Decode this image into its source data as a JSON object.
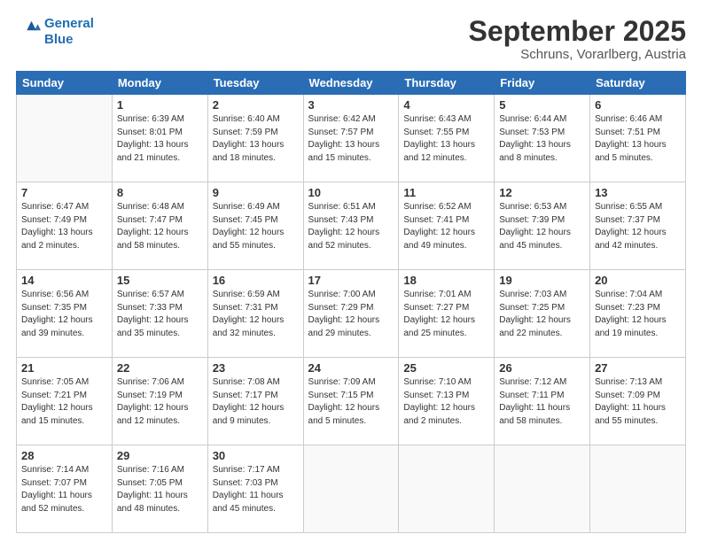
{
  "logo": {
    "line1": "General",
    "line2": "Blue"
  },
  "title": "September 2025",
  "subtitle": "Schruns, Vorarlberg, Austria",
  "weekdays": [
    "Sunday",
    "Monday",
    "Tuesday",
    "Wednesday",
    "Thursday",
    "Friday",
    "Saturday"
  ],
  "weeks": [
    [
      {
        "day": "",
        "text": ""
      },
      {
        "day": "1",
        "text": "Sunrise: 6:39 AM\nSunset: 8:01 PM\nDaylight: 13 hours\nand 21 minutes."
      },
      {
        "day": "2",
        "text": "Sunrise: 6:40 AM\nSunset: 7:59 PM\nDaylight: 13 hours\nand 18 minutes."
      },
      {
        "day": "3",
        "text": "Sunrise: 6:42 AM\nSunset: 7:57 PM\nDaylight: 13 hours\nand 15 minutes."
      },
      {
        "day": "4",
        "text": "Sunrise: 6:43 AM\nSunset: 7:55 PM\nDaylight: 13 hours\nand 12 minutes."
      },
      {
        "day": "5",
        "text": "Sunrise: 6:44 AM\nSunset: 7:53 PM\nDaylight: 13 hours\nand 8 minutes."
      },
      {
        "day": "6",
        "text": "Sunrise: 6:46 AM\nSunset: 7:51 PM\nDaylight: 13 hours\nand 5 minutes."
      }
    ],
    [
      {
        "day": "7",
        "text": "Sunrise: 6:47 AM\nSunset: 7:49 PM\nDaylight: 13 hours\nand 2 minutes."
      },
      {
        "day": "8",
        "text": "Sunrise: 6:48 AM\nSunset: 7:47 PM\nDaylight: 12 hours\nand 58 minutes."
      },
      {
        "day": "9",
        "text": "Sunrise: 6:49 AM\nSunset: 7:45 PM\nDaylight: 12 hours\nand 55 minutes."
      },
      {
        "day": "10",
        "text": "Sunrise: 6:51 AM\nSunset: 7:43 PM\nDaylight: 12 hours\nand 52 minutes."
      },
      {
        "day": "11",
        "text": "Sunrise: 6:52 AM\nSunset: 7:41 PM\nDaylight: 12 hours\nand 49 minutes."
      },
      {
        "day": "12",
        "text": "Sunrise: 6:53 AM\nSunset: 7:39 PM\nDaylight: 12 hours\nand 45 minutes."
      },
      {
        "day": "13",
        "text": "Sunrise: 6:55 AM\nSunset: 7:37 PM\nDaylight: 12 hours\nand 42 minutes."
      }
    ],
    [
      {
        "day": "14",
        "text": "Sunrise: 6:56 AM\nSunset: 7:35 PM\nDaylight: 12 hours\nand 39 minutes."
      },
      {
        "day": "15",
        "text": "Sunrise: 6:57 AM\nSunset: 7:33 PM\nDaylight: 12 hours\nand 35 minutes."
      },
      {
        "day": "16",
        "text": "Sunrise: 6:59 AM\nSunset: 7:31 PM\nDaylight: 12 hours\nand 32 minutes."
      },
      {
        "day": "17",
        "text": "Sunrise: 7:00 AM\nSunset: 7:29 PM\nDaylight: 12 hours\nand 29 minutes."
      },
      {
        "day": "18",
        "text": "Sunrise: 7:01 AM\nSunset: 7:27 PM\nDaylight: 12 hours\nand 25 minutes."
      },
      {
        "day": "19",
        "text": "Sunrise: 7:03 AM\nSunset: 7:25 PM\nDaylight: 12 hours\nand 22 minutes."
      },
      {
        "day": "20",
        "text": "Sunrise: 7:04 AM\nSunset: 7:23 PM\nDaylight: 12 hours\nand 19 minutes."
      }
    ],
    [
      {
        "day": "21",
        "text": "Sunrise: 7:05 AM\nSunset: 7:21 PM\nDaylight: 12 hours\nand 15 minutes."
      },
      {
        "day": "22",
        "text": "Sunrise: 7:06 AM\nSunset: 7:19 PM\nDaylight: 12 hours\nand 12 minutes."
      },
      {
        "day": "23",
        "text": "Sunrise: 7:08 AM\nSunset: 7:17 PM\nDaylight: 12 hours\nand 9 minutes."
      },
      {
        "day": "24",
        "text": "Sunrise: 7:09 AM\nSunset: 7:15 PM\nDaylight: 12 hours\nand 5 minutes."
      },
      {
        "day": "25",
        "text": "Sunrise: 7:10 AM\nSunset: 7:13 PM\nDaylight: 12 hours\nand 2 minutes."
      },
      {
        "day": "26",
        "text": "Sunrise: 7:12 AM\nSunset: 7:11 PM\nDaylight: 11 hours\nand 58 minutes."
      },
      {
        "day": "27",
        "text": "Sunrise: 7:13 AM\nSunset: 7:09 PM\nDaylight: 11 hours\nand 55 minutes."
      }
    ],
    [
      {
        "day": "28",
        "text": "Sunrise: 7:14 AM\nSunset: 7:07 PM\nDaylight: 11 hours\nand 52 minutes."
      },
      {
        "day": "29",
        "text": "Sunrise: 7:16 AM\nSunset: 7:05 PM\nDaylight: 11 hours\nand 48 minutes."
      },
      {
        "day": "30",
        "text": "Sunrise: 7:17 AM\nSunset: 7:03 PM\nDaylight: 11 hours\nand 45 minutes."
      },
      {
        "day": "",
        "text": ""
      },
      {
        "day": "",
        "text": ""
      },
      {
        "day": "",
        "text": ""
      },
      {
        "day": "",
        "text": ""
      }
    ]
  ]
}
